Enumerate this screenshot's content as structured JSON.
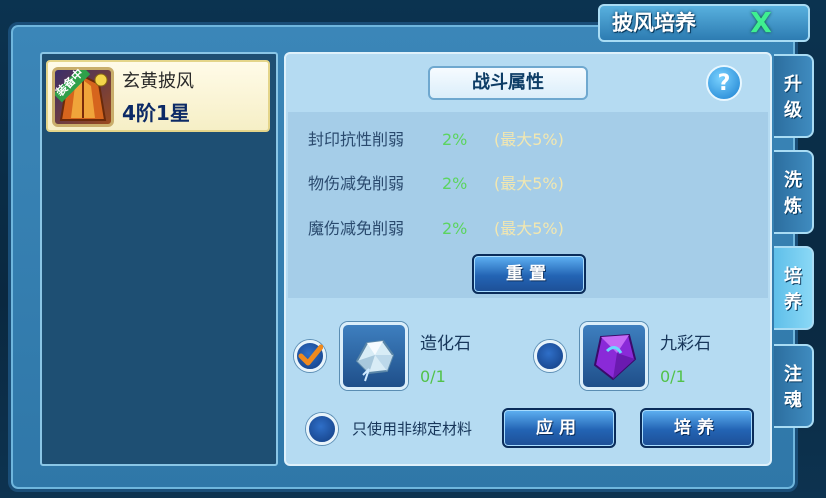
{
  "window": {
    "title": "披风培养",
    "close_glyph": "X"
  },
  "item": {
    "badge": "装备中",
    "name": "玄黄披风",
    "grade": "4阶1星"
  },
  "section": {
    "title": "战斗属性",
    "help_glyph": "?"
  },
  "stats": [
    {
      "name": "封印抗性削弱",
      "value": "2%",
      "max": "(最大5%)"
    },
    {
      "name": "物伤减免削弱",
      "value": "2%",
      "max": "(最大5%)"
    },
    {
      "name": "魔伤减免削弱",
      "value": "2%",
      "max": "(最大5%)"
    }
  ],
  "buttons": {
    "reset": "重置",
    "apply": "应用",
    "cultivate": "培养"
  },
  "materials": [
    {
      "name": "造化石",
      "count": "0/1",
      "checked": true,
      "icon": "crystal-stone-icon"
    },
    {
      "name": "九彩石",
      "count": "0/1",
      "checked": false,
      "icon": "purple-gem-icon"
    }
  ],
  "only_unbound_label": "只使用非绑定材料",
  "tabs": [
    {
      "label": "升级",
      "active": false
    },
    {
      "label": "洗炼",
      "active": false
    },
    {
      "label": "培养",
      "active": true
    },
    {
      "label": "注魂",
      "active": false
    }
  ],
  "colors": {
    "stat_value": "#5bd45f",
    "stat_max": "#f2e7b0",
    "count": "#52c24a",
    "accent": "#2364b4"
  }
}
